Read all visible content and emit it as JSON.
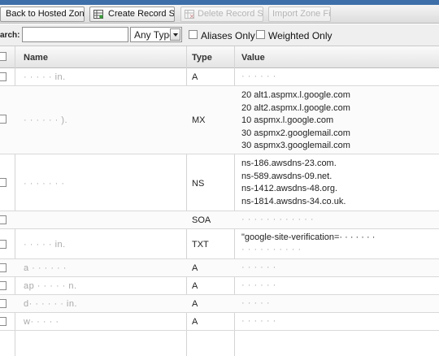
{
  "toolbar": {
    "back_label": "Back to Hosted Zones",
    "create_label": "Create Record Set",
    "delete_label": "Delete Record Set",
    "import_label": "Import Zone File"
  },
  "filter": {
    "search_label": "arch:",
    "search_value": "",
    "type_value": "Any Type",
    "aliases_label": "Aliases Only",
    "weighted_label": "Weighted Only"
  },
  "table": {
    "headers": {
      "name": "Name",
      "type": "Type",
      "value": "Value"
    },
    "rows": [
      {
        "name": "·  ·  ·  ·  ·  in.",
        "type": "A",
        "value": [
          "·  ·  ·  ·  ·  ·"
        ]
      },
      {
        "name": "· ·  ·  ·  ·  ·  ).",
        "type": "MX",
        "value": [
          "20 alt1.aspmx.l.google.com",
          "20 alt2.aspmx.l.google.com",
          "10 aspmx.l.google.com",
          "30 aspmx2.googlemail.com",
          "30 aspmx3.googlemail.com"
        ]
      },
      {
        "name": "·  ·  ·  ·  ·  ·  ·",
        "type": "NS",
        "value": [
          "ns-186.awsdns-23.com.",
          "ns-589.awsdns-09.net.",
          "ns-1412.awsdns-48.org.",
          "ns-1814.awsdns-34.co.uk."
        ]
      },
      {
        "name": "",
        "type": "SOA",
        "value": [
          "·  ·  ·  ·  ·  ·  ·  ·  ·  ·  ·  ·"
        ]
      },
      {
        "name": "·  ·  ·  ·  ·  in.",
        "type": "TXT",
        "value": [
          "\"google-site-verification=·  ·  ·  ·  ·  ·  ·",
          "·  ·  ·  ·  ·  ·  ·  ·  ·  ·"
        ]
      },
      {
        "name": "a  ·  ·  ·  ·  ·  ·",
        "type": "A",
        "value": [
          "·  ·  ·  ·  ·  ·"
        ]
      },
      {
        "name": "ap  ·  ·  ·  ·  ·  n.",
        "type": "A",
        "value": [
          "·  ·  ·  ·  ·  ·"
        ]
      },
      {
        "name": "d·  ·  ·  ·  ·  ·  in.",
        "type": "A",
        "value": [
          "·  ·  ·  ·  ·"
        ]
      },
      {
        "name": "w·  ·  ·  ·  ·",
        "type": "A",
        "value": [
          "·  ·  ·  ·  ·  ·"
        ]
      }
    ]
  },
  "colors": {
    "accent": "#3e6fa8",
    "header_bg": "#e4e4e4",
    "grid_line": "#d9d9d9"
  }
}
